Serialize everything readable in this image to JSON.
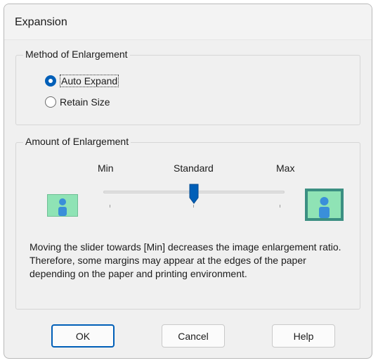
{
  "dialog": {
    "title": "Expansion"
  },
  "method_group": {
    "label": "Method of Enlargement",
    "options": [
      {
        "label": "Auto Expand",
        "selected": true
      },
      {
        "label": "Retain Size",
        "selected": false
      }
    ]
  },
  "amount_group": {
    "label": "Amount of Enlargement",
    "tick_labels": {
      "min": "Min",
      "standard": "Standard",
      "max": "Max"
    },
    "slider_level": "Standard",
    "description_lines": [
      "Moving the slider towards [Min] decreases the image enlargement ratio.",
      "Therefore, some margins may appear at the edges of the paper depending on the paper and printing environment."
    ]
  },
  "buttons": {
    "ok": "OK",
    "cancel": "Cancel",
    "help": "Help"
  },
  "colors": {
    "accent": "#005fb8",
    "picture_bg": "#8fe3b5",
    "picture_person": "#3a8fd9",
    "picture_frame": "#3b8f82"
  }
}
